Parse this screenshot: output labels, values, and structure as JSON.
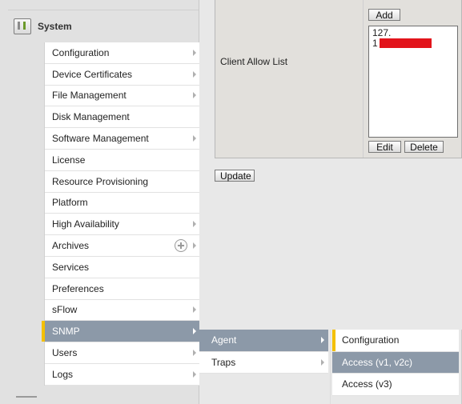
{
  "section": {
    "title": "System"
  },
  "menu": [
    {
      "label": "Configuration",
      "arrow": true
    },
    {
      "label": "Device Certificates",
      "arrow": true
    },
    {
      "label": "File Management",
      "arrow": true
    },
    {
      "label": "Disk Management",
      "arrow": false
    },
    {
      "label": "Software Management",
      "arrow": true
    },
    {
      "label": "License",
      "arrow": false
    },
    {
      "label": "Resource Provisioning",
      "arrow": false
    },
    {
      "label": "Platform",
      "arrow": false
    },
    {
      "label": "High Availability",
      "arrow": true
    },
    {
      "label": "Archives",
      "arrow": true
    },
    {
      "label": "Services",
      "arrow": false
    },
    {
      "label": "Preferences",
      "arrow": false
    },
    {
      "label": "sFlow",
      "arrow": true
    },
    {
      "label": "SNMP",
      "arrow": true
    },
    {
      "label": "Users",
      "arrow": true
    },
    {
      "label": "Logs",
      "arrow": true
    }
  ],
  "snmp_submenu": [
    {
      "label": "Agent"
    },
    {
      "label": "Traps"
    }
  ],
  "agent_submenu": [
    {
      "label": "Configuration"
    },
    {
      "label": "Access (v1, v2c)"
    },
    {
      "label": "Access (v3)"
    }
  ],
  "form": {
    "client_allow_list_label": "Client Allow List",
    "add_label": "Add",
    "list_entries": [
      "127.",
      "1"
    ],
    "edit_label": "Edit",
    "delete_label": "Delete",
    "update_label": "Update"
  },
  "colors": {
    "active_bg": "#8c99a8",
    "active_flag": "#f4c000",
    "redaction": "#e2141b"
  }
}
